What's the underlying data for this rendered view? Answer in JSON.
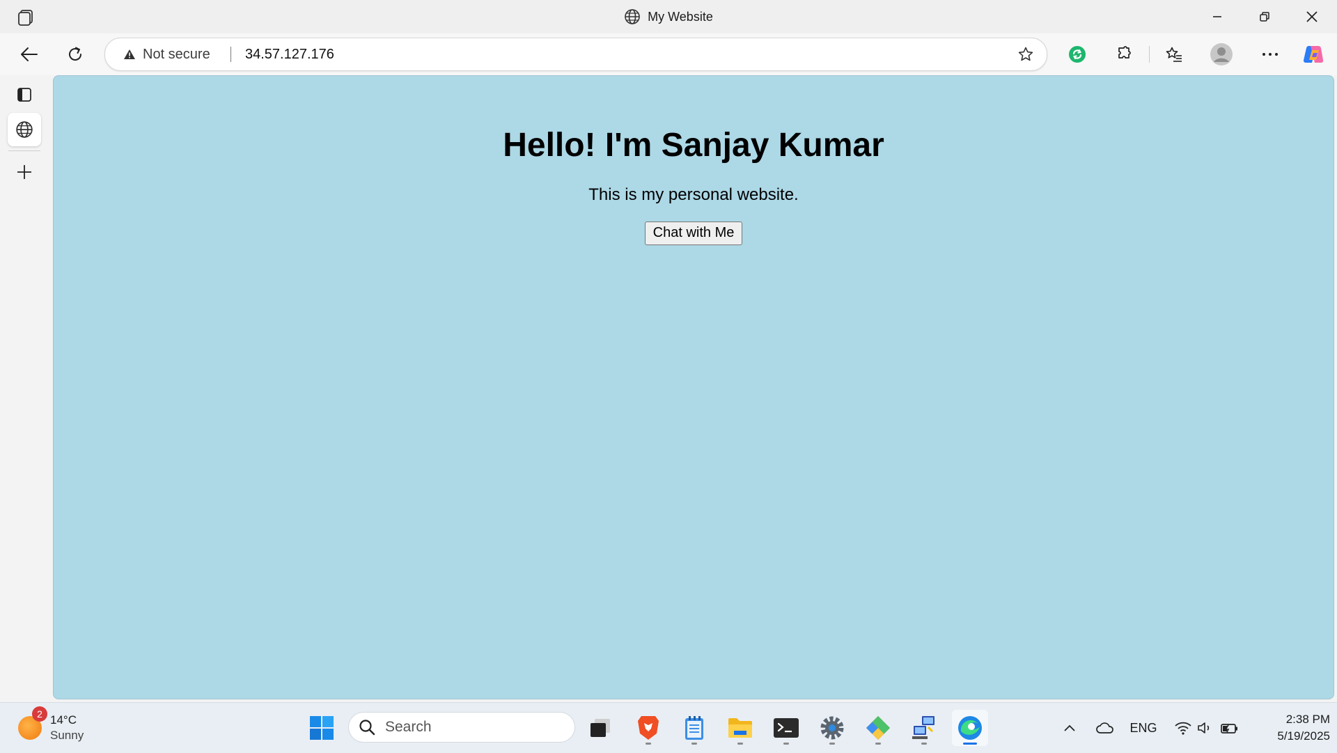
{
  "window": {
    "title": "My Website"
  },
  "toolbar": {
    "security_label": "Not secure",
    "url": "34.57.127.176"
  },
  "page": {
    "heading": "Hello! I'm Sanjay Kumar",
    "paragraph": "This is my personal website.",
    "button_label": "Chat with Me",
    "background_color": "#add8e6"
  },
  "taskbar": {
    "weather": {
      "temperature": "14°C",
      "condition": "Sunny",
      "badge_count": "2"
    },
    "search_placeholder": "Search",
    "apps": [
      "windows-start",
      "task-view",
      "brave",
      "notepad",
      "file-explorer",
      "terminal",
      "settings",
      "git",
      "network-tool",
      "edge"
    ],
    "language": "ENG",
    "time": "2:38 PM",
    "date": "5/19/2025"
  }
}
